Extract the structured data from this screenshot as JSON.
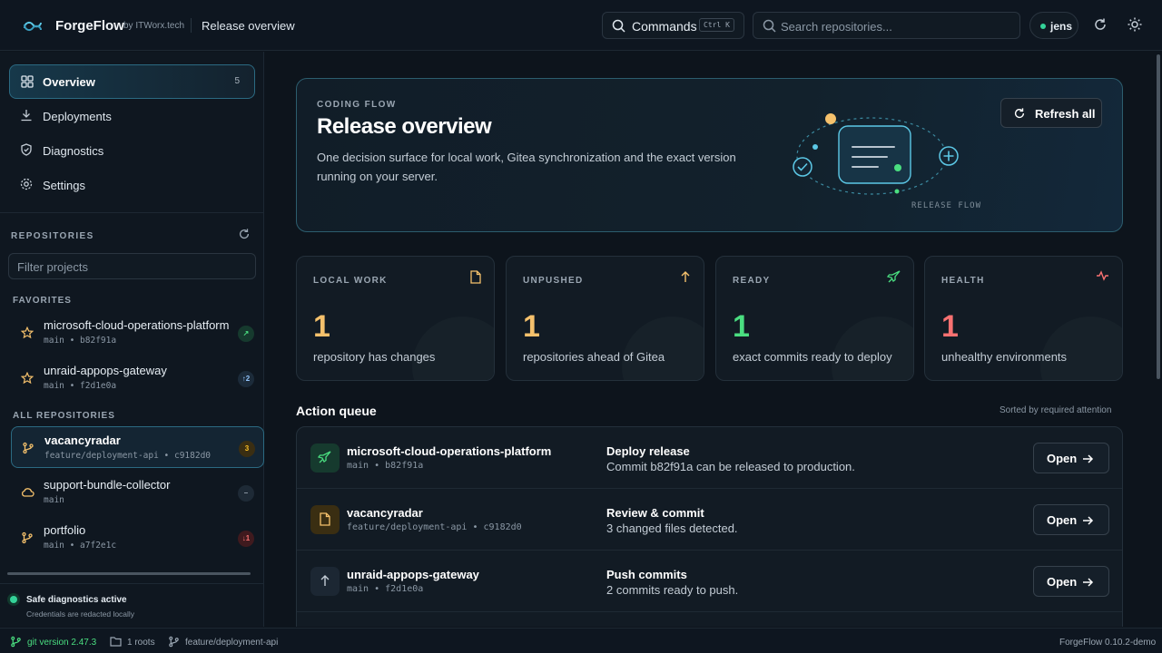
{
  "app": {
    "name": "ForgeFlow",
    "by": "by ITWorx.tech",
    "page_title": "Release overview"
  },
  "topbar": {
    "commands_label": "Commands",
    "commands_shortcut": "Ctrl K",
    "search_placeholder": "Search repositories...",
    "user": "jens"
  },
  "nav": [
    {
      "label": "Overview",
      "count": "5",
      "icon": "grid-icon"
    },
    {
      "label": "Deployments",
      "icon": "download-icon"
    },
    {
      "label": "Diagnostics",
      "icon": "shield-icon"
    },
    {
      "label": "Settings",
      "icon": "gear-icon"
    }
  ],
  "repositories": {
    "title": "REPOSITORIES",
    "filter_placeholder": "Filter projects",
    "favorites_title": "FAVORITES",
    "all_title": "ALL REPOSITORIES",
    "favorites": [
      {
        "name": "microsoft-cloud-operations-platform",
        "branch": "main • b82f91a",
        "badge": "↗"
      },
      {
        "name": "unraid-appops-gateway",
        "branch": "main • f2d1e0a",
        "badge": "↑2"
      }
    ],
    "all": [
      {
        "name": "vacancyradar",
        "branch": "feature/deployment-api • c9182d0",
        "badge": "3"
      },
      {
        "name": "support-bundle-collector",
        "branch": "main",
        "badge": "–"
      },
      {
        "name": "portfolio",
        "branch": "main • a7f2e1c",
        "badge": "↓1"
      }
    ]
  },
  "safe": {
    "title": "Safe diagnostics active",
    "subtitle": "Credentials are redacted locally"
  },
  "statusbar": {
    "git": "git version 2.47.3",
    "roots": "1 roots",
    "branch": "feature/deployment-api",
    "version": "ForgeFlow 0.10.2-demo"
  },
  "hero": {
    "kicker": "CODING FLOW",
    "title": "Release overview",
    "description": "One decision surface for local work, Gitea synchronization and the exact version running on your server.",
    "art_label": "RELEASE FLOW",
    "refresh_label": "Refresh all"
  },
  "stats": [
    {
      "label": "LOCAL WORK",
      "value": "1",
      "caption": "repository has changes",
      "color": "#f5c16c",
      "icon": "file-icon"
    },
    {
      "label": "UNPUSHED",
      "value": "1",
      "caption": "repositories ahead of Gitea",
      "color": "#f5c16c",
      "icon": "arrow-up-icon"
    },
    {
      "label": "READY",
      "value": "1",
      "caption": "exact commits ready to deploy",
      "color": "#4ade80",
      "icon": "rocket-icon"
    },
    {
      "label": "HEALTH",
      "value": "1",
      "caption": "unhealthy environments",
      "color": "#f87171",
      "icon": "pulse-icon"
    }
  ],
  "queue": {
    "title": "Action queue",
    "sort_note": "Sorted by required attention",
    "open_label": "Open",
    "rows": [
      {
        "repo": "microsoft-cloud-operations-platform",
        "branch": "main • b82f91a",
        "action": "Deploy release",
        "detail": "Commit b82f91a can be released to production.",
        "icon": "rocket-icon"
      },
      {
        "repo": "vacancyradar",
        "branch": "feature/deployment-api • c9182d0",
        "action": "Review & commit",
        "detail": "3 changed files detected.",
        "icon": "file-icon"
      },
      {
        "repo": "unraid-appops-gateway",
        "branch": "main • f2d1e0a",
        "action": "Push commits",
        "detail": "2 commits ready to push.",
        "icon": "arrow-up-icon"
      }
    ]
  }
}
